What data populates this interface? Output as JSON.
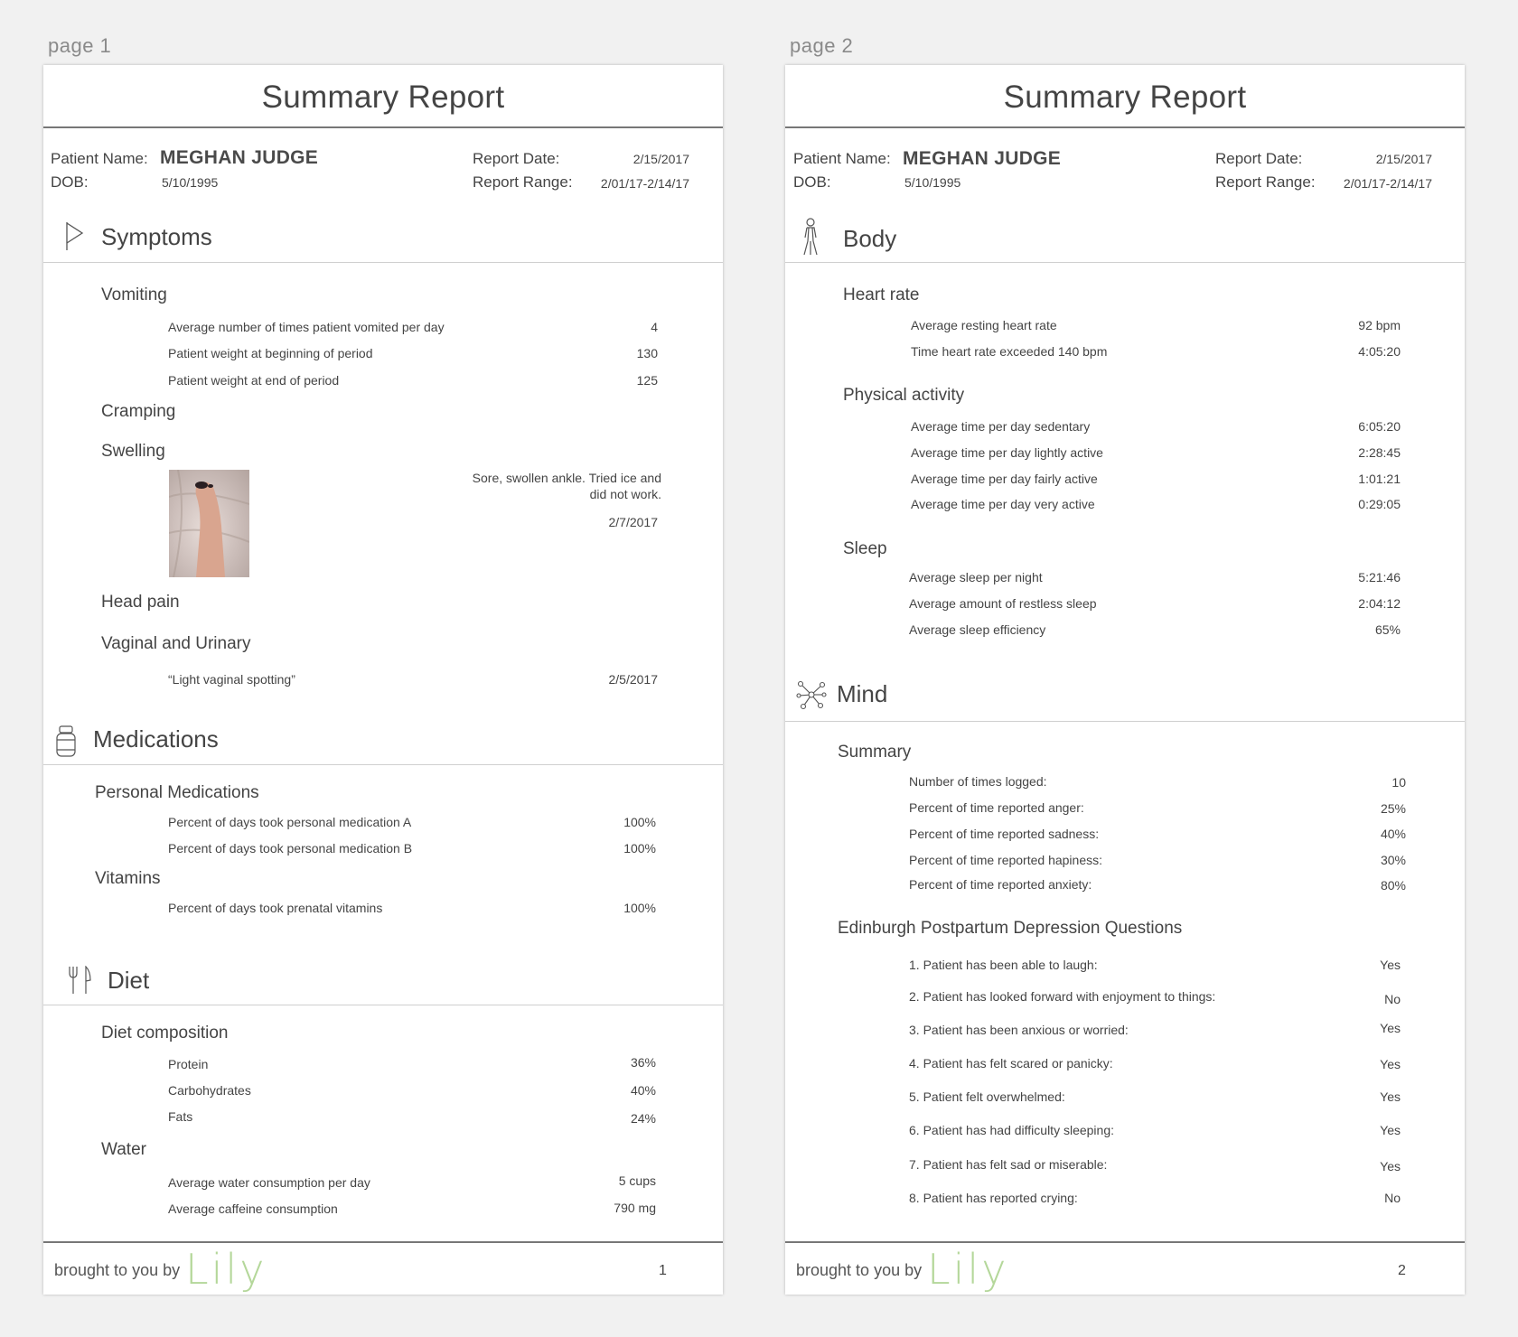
{
  "pages": [
    {
      "label": "page 1",
      "title": "Summary Report",
      "header": {
        "patient_name_label": "Patient Name:",
        "patient_name": "MEGHAN JUDGE",
        "dob_label": "DOB:",
        "dob": "5/10/1995",
        "report_date_label": "Report Date:",
        "report_date": "2/15/2017",
        "report_range_label": "Report Range:",
        "report_range": "2/01/17-2/14/17"
      },
      "symptoms": {
        "title": "Symptoms",
        "vomiting": {
          "title": "Vomiting",
          "rows": [
            {
              "label": "Average number of times patient vomited per day",
              "value": "4"
            },
            {
              "label": "Patient weight at beginning of period",
              "value": "130"
            },
            {
              "label": "Patient weight at end of period",
              "value": "125"
            }
          ]
        },
        "cramping": "Cramping",
        "swelling": {
          "title": "Swelling",
          "note": "Sore, swollen ankle. Tried ice and did not work.",
          "date": "2/7/2017"
        },
        "head_pain": "Head pain",
        "vaginal": {
          "title": "Vaginal and Urinary",
          "note": "“Light vaginal spotting”",
          "date": "2/5/2017"
        }
      },
      "medications": {
        "title": "Medications",
        "personal": {
          "title": "Personal Medications",
          "rows": [
            {
              "label": "Percent of days took personal medication A",
              "value": "100%"
            },
            {
              "label": "Percent of days took personal medication B",
              "value": "100%"
            }
          ]
        },
        "vitamins": {
          "title": "Vitamins",
          "rows": [
            {
              "label": "Percent of days took prenatal vitamins",
              "value": "100%"
            }
          ]
        }
      },
      "diet": {
        "title": "Diet",
        "composition": {
          "title": "Diet composition",
          "rows": [
            {
              "label": "Protein",
              "value": "36%"
            },
            {
              "label": "Carbohydrates",
              "value": "40%"
            },
            {
              "label": "Fats",
              "value": "24%"
            }
          ]
        },
        "water": {
          "title": "Water",
          "rows": [
            {
              "label": "Average water consumption per day",
              "value": "5 cups"
            },
            {
              "label": "Average caffeine consumption",
              "value": "790 mg"
            }
          ]
        }
      },
      "footer": {
        "brought_by": "brought to you by",
        "brand": "Lily",
        "page_number": "1"
      }
    },
    {
      "label": "page 2",
      "title": "Summary Report",
      "header": {
        "patient_name_label": "Patient Name:",
        "patient_name": "MEGHAN JUDGE",
        "dob_label": "DOB:",
        "dob": "5/10/1995",
        "report_date_label": "Report Date:",
        "report_date": "2/15/2017",
        "report_range_label": "Report Range:",
        "report_range": "2/01/17-2/14/17"
      },
      "body": {
        "title": "Body",
        "heart_rate": {
          "title": "Heart rate",
          "rows": [
            {
              "label": "Average resting heart rate",
              "value": "92 bpm"
            },
            {
              "label": "Time heart rate exceeded 140 bpm",
              "value": "4:05:20"
            }
          ]
        },
        "activity": {
          "title": "Physical activity",
          "rows": [
            {
              "label": "Average time per day sedentary",
              "value": "6:05:20"
            },
            {
              "label": "Average time per day lightly active",
              "value": "2:28:45"
            },
            {
              "label": "Average time per day fairly active",
              "value": "1:01:21"
            },
            {
              "label": "Average time per day very active",
              "value": "0:29:05"
            }
          ]
        },
        "sleep": {
          "title": "Sleep",
          "rows": [
            {
              "label": "Average sleep per night",
              "value": "5:21:46"
            },
            {
              "label": "Average amount of restless sleep",
              "value": "2:04:12"
            },
            {
              "label": "Average sleep efficiency",
              "value": "65%"
            }
          ]
        }
      },
      "mind": {
        "title": "Mind",
        "summary": {
          "title": "Summary",
          "rows": [
            {
              "label": "Number of times logged:",
              "value": "10"
            },
            {
              "label": "Percent of time reported anger:",
              "value": "25%"
            },
            {
              "label": "Percent of time reported sadness:",
              "value": "40%"
            },
            {
              "label": "Percent of time reported hapiness:",
              "value": "30%"
            },
            {
              "label": "Percent of time reported anxiety:",
              "value": "80%"
            }
          ]
        },
        "epds": {
          "title": "Edinburgh Postpartum Depression Questions",
          "rows": [
            {
              "label": "1.  Patient has been able to laugh:",
              "value": "Yes"
            },
            {
              "label": "2. Patient has looked forward with enjoyment to things:",
              "value": "No"
            },
            {
              "label": "3. Patient has been anxious or worried:",
              "value": "Yes"
            },
            {
              "label": "4. Patient has felt scared or panicky:",
              "value": "Yes"
            },
            {
              "label": "5. Patient felt overwhelmed:",
              "value": "Yes"
            },
            {
              "label": "6. Patient has had difficulty sleeping:",
              "value": "Yes"
            },
            {
              "label": "7. Patient has felt sad or miserable:",
              "value": "Yes"
            },
            {
              "label": "8. Patient has reported crying:",
              "value": "No"
            }
          ]
        }
      },
      "footer": {
        "brought_by": "brought to you by",
        "brand": "Lily",
        "page_number": "2"
      }
    }
  ],
  "icons": {
    "symptoms": "flag-icon",
    "medications": "pill-bottle-icon",
    "diet": "fork-knife-icon",
    "body": "walking-person-icon",
    "mind": "network-nodes-icon"
  },
  "colors": {
    "brand": "#b4d79a",
    "background": "#f1f1f1",
    "page": "#ffffff"
  }
}
